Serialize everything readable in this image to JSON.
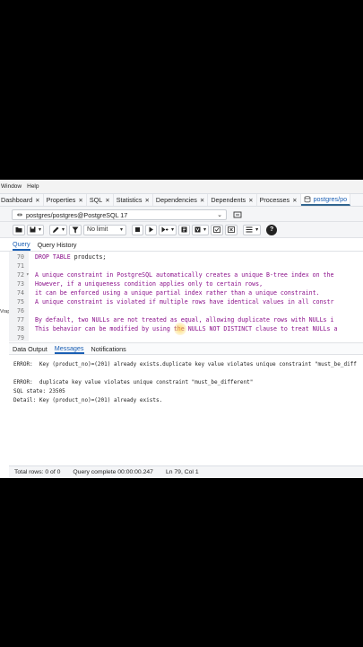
{
  "menu": {
    "items": [
      "Window",
      "Help"
    ]
  },
  "tabs": [
    {
      "label": "Dashboard",
      "close": "✕"
    },
    {
      "label": "Properties",
      "close": "✕"
    },
    {
      "label": "SQL",
      "close": "✕"
    },
    {
      "label": "Statistics",
      "close": "✕"
    },
    {
      "label": "Dependencies",
      "close": "✕"
    },
    {
      "label": "Dependents",
      "close": "✕"
    },
    {
      "label": "Processes",
      "close": "✕"
    },
    {
      "label": "postgres/po",
      "close": ""
    }
  ],
  "connection": {
    "value": "postgres/postgres@PostgreSQL 17"
  },
  "toolbar": {
    "limit_label": "No limit"
  },
  "query_tabs": [
    "Query",
    "Query History"
  ],
  "editor": {
    "lines": [
      {
        "n": "70",
        "fold": "",
        "parts": [
          {
            "t": "DROP TABLE ",
            "k": 1
          },
          {
            "t": "products;",
            "k": 0
          }
        ]
      },
      {
        "n": "71",
        "fold": "",
        "parts": []
      },
      {
        "n": "72",
        "fold": "▾",
        "parts": [
          {
            "t": "A unique constraint in PostgreSQL automatically creates a unique B-tree index on the",
            "k": 1
          }
        ]
      },
      {
        "n": "73",
        "fold": "",
        "parts": [
          {
            "t": "However, if a uniqueness condition applies only to certain rows,",
            "k": 1
          }
        ]
      },
      {
        "n": "74",
        "fold": "",
        "parts": [
          {
            "t": "it can be enforced using a unique partial index rather than a unique constraint.",
            "k": 1
          }
        ]
      },
      {
        "n": "75",
        "fold": "",
        "parts": [
          {
            "t": "A unique constraint is violated if multiple rows have identical values in all constr",
            "k": 1
          }
        ]
      },
      {
        "n": "76",
        "fold": "",
        "parts": []
      },
      {
        "n": "77",
        "fold": "",
        "parts": [
          {
            "t": "By default, two NULLs are not treated as equal, allowing duplicate rows with NULLs i",
            "k": 1
          }
        ]
      },
      {
        "n": "78",
        "fold": "",
        "parts": [
          {
            "t": "This behavior can be modified by using the NULLS NOT DISTINCT clause to treat NULLs a",
            "k": 1
          }
        ]
      },
      {
        "n": "79",
        "fold": "",
        "parts": []
      }
    ],
    "wrap_tag": "Vrap"
  },
  "output_tabs": [
    "Data Output",
    "Messages",
    "Notifications"
  ],
  "messages": [
    "ERROR:  Key (product_no)=(201) already exists.duplicate key value violates unique constraint \"must_be_diff",
    "",
    "ERROR:  duplicate key value violates unique constraint \"must_be_different\"",
    "SQL state: 23505",
    "Detail: Key (product_no)=(201) already exists."
  ],
  "status": {
    "total_rows": "Total rows: 0 of 0",
    "query_complete": "Query complete 00:00:00.247",
    "position": "Ln 79, Col 1"
  }
}
